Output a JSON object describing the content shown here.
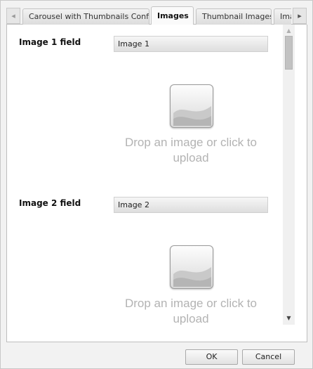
{
  "tabs": {
    "scroll_left_icon": "◂",
    "scroll_right_icon": "▸",
    "items": [
      {
        "label": "Carousel with Thumbnails Config",
        "active": false
      },
      {
        "label": "Images",
        "active": true
      },
      {
        "label": "Thumbnail Images",
        "active": false
      },
      {
        "label": "Ima",
        "active": false
      }
    ]
  },
  "fields": [
    {
      "label": "Image 1 field",
      "value": "Image 1",
      "drop_text": "Drop an image or click to upload"
    },
    {
      "label": "Image 2 field",
      "value": "Image 2",
      "drop_text": "Drop an image or click to upload"
    }
  ],
  "scrollbar": {
    "up_icon": "▲",
    "down_icon": "▼"
  },
  "footer": {
    "ok_label": "OK",
    "cancel_label": "Cancel"
  }
}
